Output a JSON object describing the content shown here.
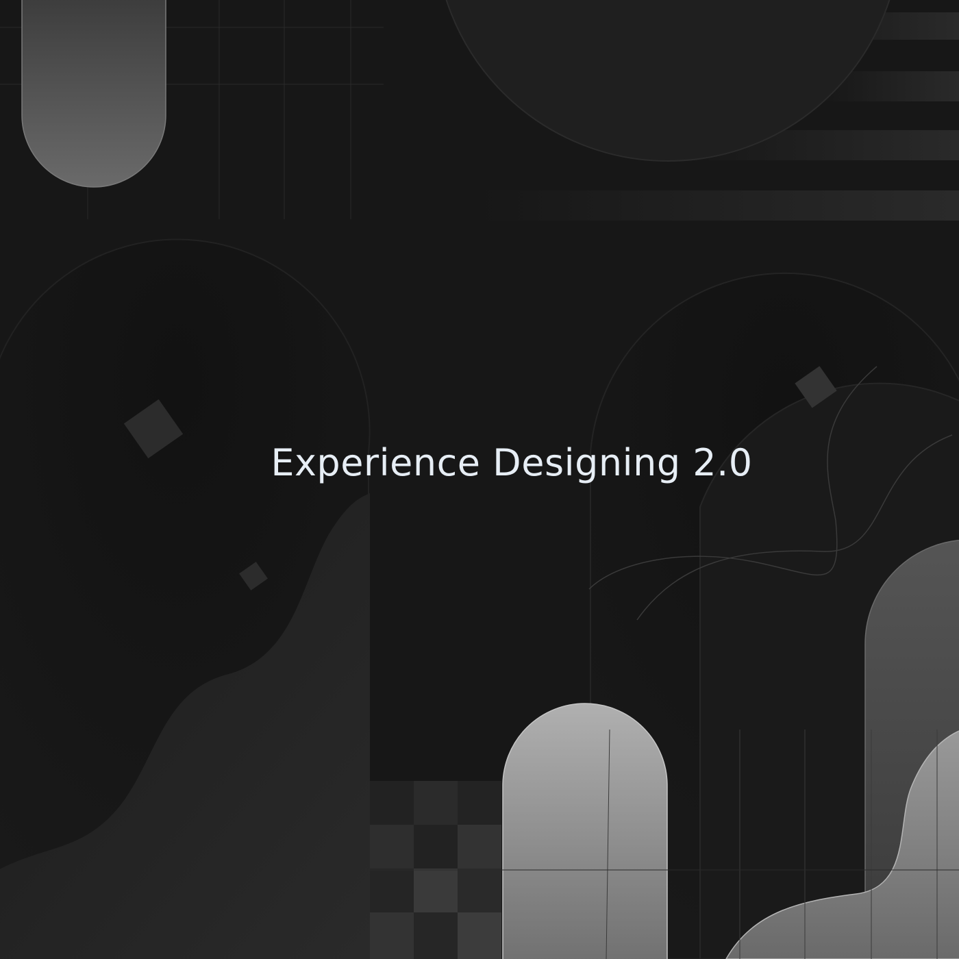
{
  "artwork": {
    "headline": "Experience Designing 2.0",
    "colors": {
      "background": "#171717",
      "panel_dark": "#131313",
      "panel_mid": "#1d1d1d",
      "glass_light": "#a8a8a8",
      "glass_mid": "#5a5a5a",
      "text": "#e7eef5"
    }
  }
}
